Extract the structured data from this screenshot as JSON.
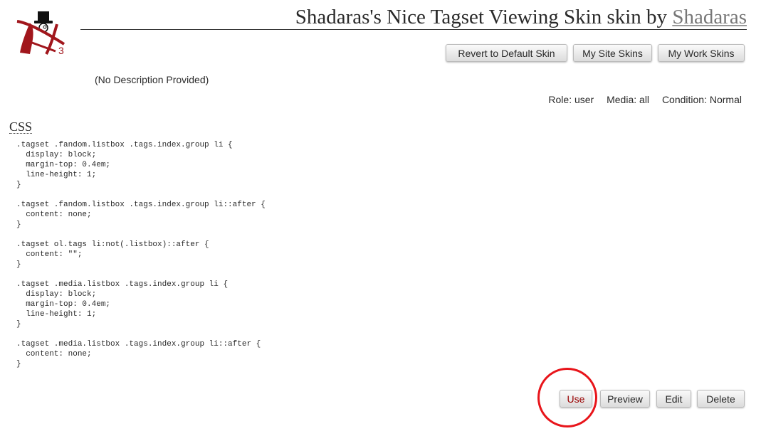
{
  "header": {
    "title_prefix": "Shadaras's Nice Tagset Viewing Skin skin by",
    "author": "Shadaras",
    "logo_icon": "ao3-logo-icon"
  },
  "nav": {
    "revert_label": "Revert to Default Skin",
    "site_skins_label": "My Site Skins",
    "work_skins_label": "My Work Skins"
  },
  "description": "(No Description Provided)",
  "meta": {
    "role_label": "Role:",
    "role_value": "user",
    "media_label": "Media:",
    "media_value": "all",
    "condition_label": "Condition:",
    "condition_value": "Normal"
  },
  "css_section": {
    "heading": "CSS",
    "code": ".tagset .fandom.listbox .tags.index.group li {\n  display: block;\n  margin-top: 0.4em;\n  line-height: 1;\n}\n\n.tagset .fandom.listbox .tags.index.group li::after {\n  content: none;\n}\n\n.tagset ol.tags li:not(.listbox)::after {\n  content: \"\";\n}\n\n.tagset .media.listbox .tags.index.group li {\n  display: block;\n  margin-top: 0.4em;\n  line-height: 1;\n}\n\n.tagset .media.listbox .tags.index.group li::after {\n  content: none;\n}"
  },
  "actions": {
    "use_label": "Use",
    "preview_label": "Preview",
    "edit_label": "Edit",
    "delete_label": "Delete"
  },
  "colors": {
    "use_text": "#990000",
    "highlight_circle": "#e8151b",
    "logo_red": "#a1161c"
  }
}
